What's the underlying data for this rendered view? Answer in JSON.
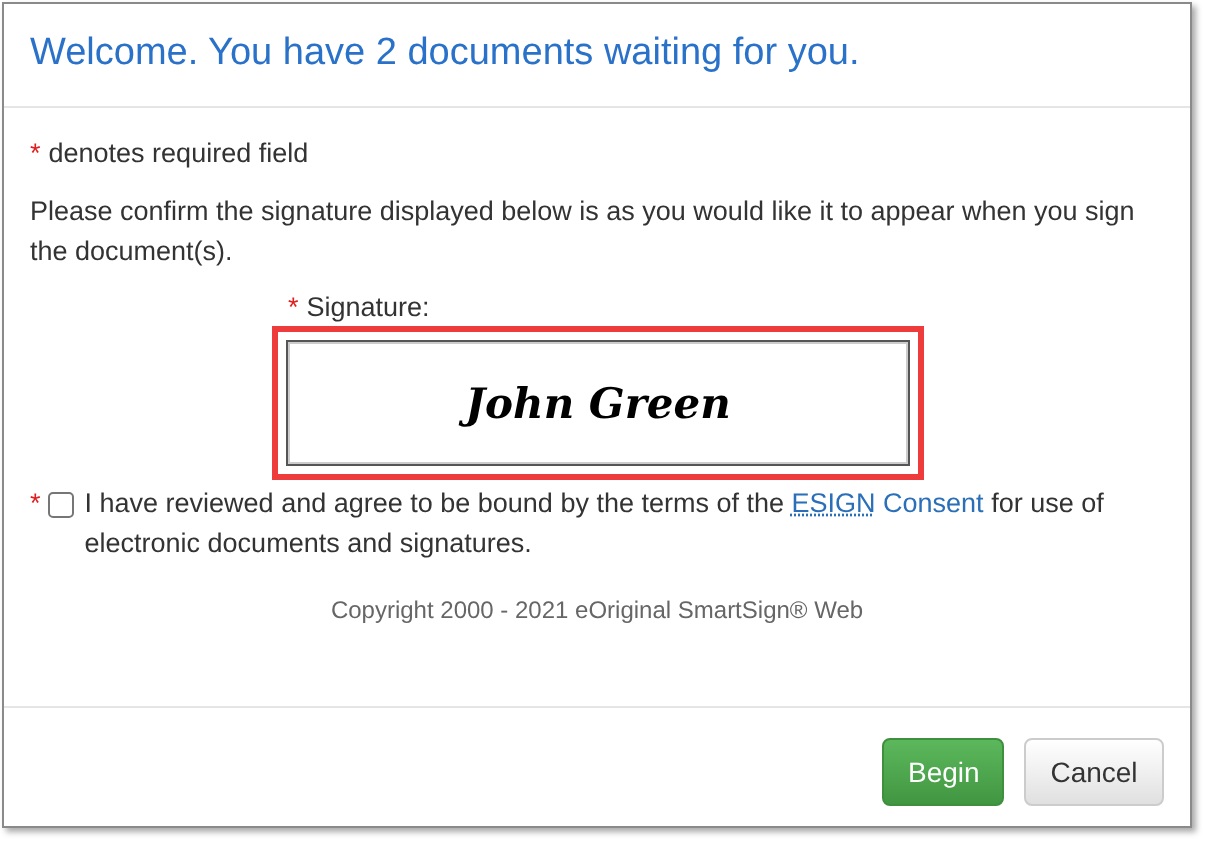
{
  "title": "Welcome. You have 2 documents waiting for you.",
  "required_note": {
    "mark": "*",
    "text": "denotes required field"
  },
  "instructions": "Please confirm the signature displayed below is as you would like it to appear when you sign the document(s).",
  "signature": {
    "mark": "*",
    "label": "Signature:",
    "value": "John Green",
    "highlighted": true
  },
  "consent": {
    "mark": "*",
    "checked": false,
    "text_before": "I have reviewed and agree to be bound by the terms of the",
    "link_abbr": "ESIGN",
    "link_text": "Consent",
    "text_after": "for use of electronic documents and signatures."
  },
  "copyright": "Copyright 2000 - 2021 eOriginal SmartSign® Web",
  "buttons": [
    {
      "label": "Begin",
      "kind": "primary"
    },
    {
      "label": "Cancel",
      "kind": "default"
    }
  ]
}
